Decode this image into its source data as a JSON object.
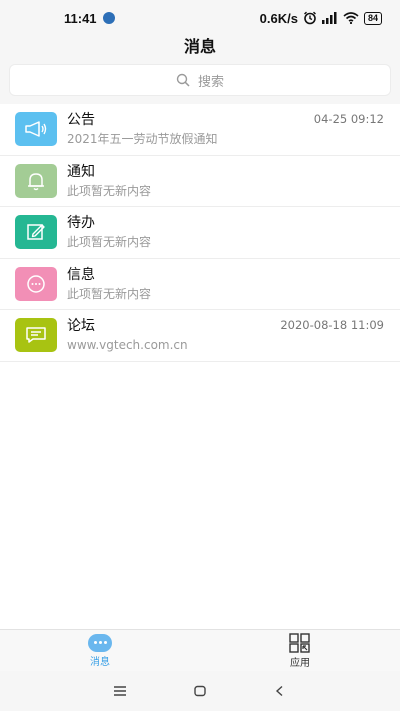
{
  "status_bar": {
    "time": "11:41",
    "network_speed": "0.6K/s",
    "battery": "84"
  },
  "header": {
    "title": "消息"
  },
  "search": {
    "placeholder": "搜索"
  },
  "list": {
    "items": [
      {
        "name": "announcement",
        "title": "公告",
        "subtitle": "2021年五一劳动节放假通知",
        "time": "04-25 09:12",
        "icon": "megaphone-icon",
        "color": "#5cc0f0"
      },
      {
        "name": "notification",
        "title": "通知",
        "subtitle": "此项暂无新内容",
        "time": "",
        "icon": "bell-icon",
        "color": "#a3cc95"
      },
      {
        "name": "todo",
        "title": "待办",
        "subtitle": "此项暂无新内容",
        "time": "",
        "icon": "edit-icon",
        "color": "#25b793"
      },
      {
        "name": "message",
        "title": "信息",
        "subtitle": "此项暂无新内容",
        "time": "",
        "icon": "chat-dots-icon",
        "color": "#f28fb6"
      },
      {
        "name": "forum",
        "title": "论坛",
        "subtitle": "www.vgtech.com.cn",
        "time": "2020-08-18 11:09",
        "icon": "chat-bubble-icon",
        "color": "#a8c312"
      }
    ]
  },
  "tab_bar": {
    "tabs": [
      {
        "label": "消息",
        "icon": "chat-icon",
        "active": true
      },
      {
        "label": "应用",
        "icon": "apps-grid-icon",
        "active": false
      }
    ]
  },
  "colors": {
    "accent": "#3aa0e6"
  }
}
